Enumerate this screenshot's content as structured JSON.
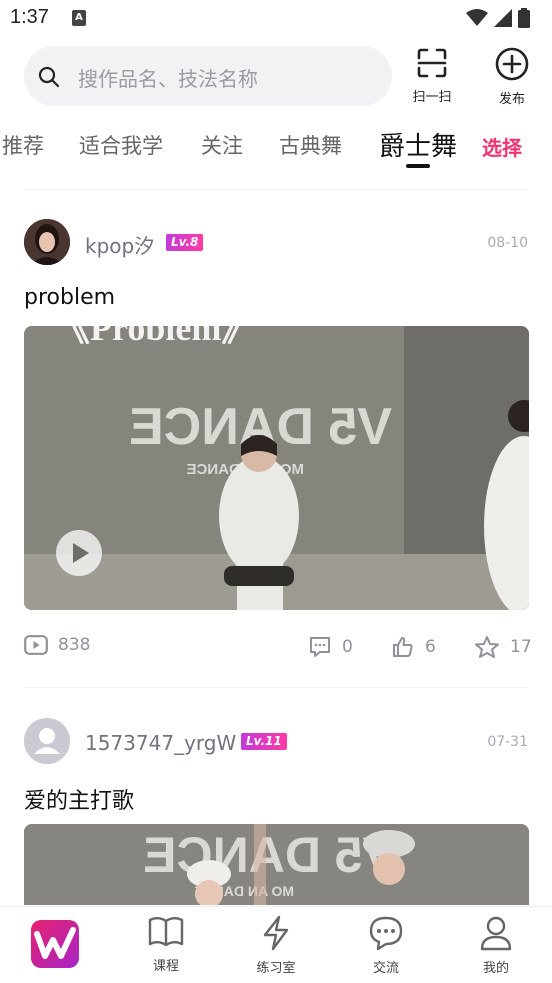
{
  "status_bar": {
    "time": "1:37",
    "notification_icon_letter": "A"
  },
  "search": {
    "placeholder": "搜作品名、技法名称"
  },
  "top_actions": {
    "scan_label": "扫一扫",
    "publish_label": "发布"
  },
  "tabs": {
    "items": [
      {
        "label": "推荐"
      },
      {
        "label": "适合我学"
      },
      {
        "label": "关注"
      },
      {
        "label": "古典舞"
      },
      {
        "label": "爵士舞",
        "active": true
      }
    ],
    "select_label": "选择"
  },
  "feed": [
    {
      "username": "kpop汐",
      "level": "Lv.8",
      "date": "08-10",
      "title": "problem",
      "thumb_text": {
        "banner": "《Problem》",
        "brand": "V5 DANCE",
        "sub": "MORE    N DANCE"
      },
      "views": "838",
      "comments": "0",
      "likes": "6",
      "favorites": "17"
    },
    {
      "username": "1573747_yrgW",
      "level": "Lv.11",
      "date": "07-31",
      "title": "爱的主打歌",
      "thumb_text": {
        "brand": "V5 DANCE",
        "sub": "MO    AN DANCE"
      }
    }
  ],
  "bottom_nav": {
    "items": [
      {
        "label": "课程"
      },
      {
        "label": "练习室"
      },
      {
        "label": "交流"
      },
      {
        "label": "我的"
      }
    ]
  },
  "colors": {
    "accent": "#f0336e",
    "badge_gradient_start": "#c23ad8",
    "badge_gradient_end": "#ff3aa6",
    "brand_logo": "#e8226d"
  }
}
